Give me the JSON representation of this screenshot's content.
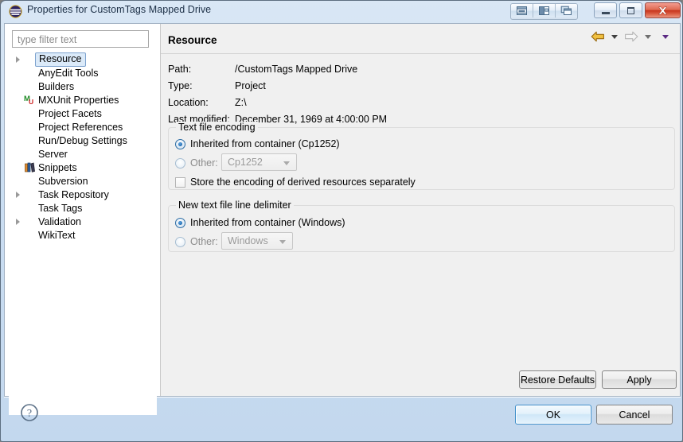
{
  "window": {
    "title": "Properties for CustomTags Mapped Drive",
    "icon": "eclipse-icon",
    "toolbar_buttons": [
      {
        "name": "restore-layout-icon"
      },
      {
        "name": "dock-left-icon"
      },
      {
        "name": "cascade-icon"
      }
    ],
    "controls": {
      "minimize": "minimize-button",
      "maximize": "maximize-button",
      "close": "close-button"
    }
  },
  "sidebar": {
    "filter": {
      "placeholder": "type filter text",
      "value": ""
    },
    "items": [
      {
        "label": "Resource",
        "expandable": true,
        "icon": "",
        "selected": true
      },
      {
        "label": "AnyEdit Tools",
        "expandable": false,
        "icon": "",
        "selected": false
      },
      {
        "label": "Builders",
        "expandable": false,
        "icon": "",
        "selected": false
      },
      {
        "label": "MXUnit Properties",
        "expandable": false,
        "icon": "mxunit-icon",
        "selected": false
      },
      {
        "label": "Project Facets",
        "expandable": false,
        "icon": "",
        "selected": false
      },
      {
        "label": "Project References",
        "expandable": false,
        "icon": "",
        "selected": false
      },
      {
        "label": "Run/Debug Settings",
        "expandable": false,
        "icon": "",
        "selected": false
      },
      {
        "label": "Server",
        "expandable": false,
        "icon": "",
        "selected": false
      },
      {
        "label": "Snippets",
        "expandable": false,
        "icon": "snippets-icon",
        "selected": false
      },
      {
        "label": "Subversion",
        "expandable": false,
        "icon": "",
        "selected": false
      },
      {
        "label": "Task Repository",
        "expandable": true,
        "icon": "",
        "selected": false
      },
      {
        "label": "Task Tags",
        "expandable": false,
        "icon": "",
        "selected": false
      },
      {
        "label": "Validation",
        "expandable": true,
        "icon": "",
        "selected": false
      },
      {
        "label": "WikiText",
        "expandable": false,
        "icon": "",
        "selected": false
      }
    ]
  },
  "page": {
    "title": "Resource",
    "nav": {
      "back": "back-arrow",
      "back_menu": "back-dropdown",
      "forward": "forward-arrow",
      "forward_menu": "forward-dropdown",
      "view_menu": "view-menu-dropdown"
    },
    "info": [
      {
        "label": "Path:",
        "value": "/CustomTags Mapped Drive"
      },
      {
        "label": "Type:",
        "value": "Project"
      },
      {
        "label": "Location:",
        "value": "Z:\\"
      },
      {
        "label": "Last modified:",
        "value": "December 31, 1969 at 4:00:00 PM"
      }
    ],
    "encoding_group": {
      "legend": "Text file encoding",
      "inherited_label": "Inherited from container (Cp1252)",
      "inherited_selected": true,
      "other_label": "Other:",
      "other_selected": false,
      "other_value": "Cp1252",
      "store_derived_label": "Store the encoding of derived resources separately",
      "store_derived_checked": false
    },
    "delimiter_group": {
      "legend": "New text file line delimiter",
      "inherited_label": "Inherited from container (Windows)",
      "inherited_selected": true,
      "other_label": "Other:",
      "other_selected": false,
      "other_value": "Windows"
    },
    "restore_defaults_label": "Restore Defaults",
    "apply_label": "Apply"
  },
  "footer": {
    "help_icon": "help-icon",
    "ok_label": "OK",
    "cancel_label": "Cancel"
  },
  "colors": {
    "accent": "#3d8ec9",
    "selection_bg": "#dbeaf9",
    "selection_border": "#7da2ce",
    "close_red": "#c7341c",
    "panel_bg": "#f0f0f0",
    "radio_blue": "#1f6bb0"
  }
}
